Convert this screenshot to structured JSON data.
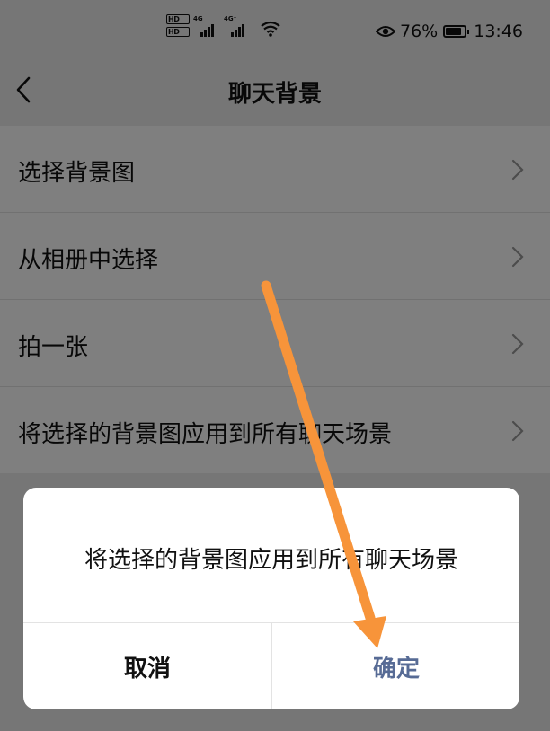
{
  "status_bar": {
    "hd1": "HD",
    "hd2": "HD",
    "net1": "4G",
    "net2": "4G⁺",
    "battery_pct": "76%",
    "time": "13:46",
    "icons": [
      "signal-icon",
      "wifi-icon",
      "eye-icon",
      "battery-icon"
    ]
  },
  "nav": {
    "title": "聊天背景",
    "back_icon": "chevron-left-icon"
  },
  "list": {
    "items": [
      {
        "label": "选择背景图"
      },
      {
        "label": "从相册中选择"
      },
      {
        "label": "拍一张"
      },
      {
        "label": "将选择的背景图应用到所有聊天场景"
      }
    ]
  },
  "dialog": {
    "message": "将选择的背景图应用到所有聊天场景",
    "cancel_label": "取消",
    "confirm_label": "确定",
    "confirm_color": "#576b95"
  },
  "colors": {
    "annotation_arrow": "#f7943a"
  }
}
